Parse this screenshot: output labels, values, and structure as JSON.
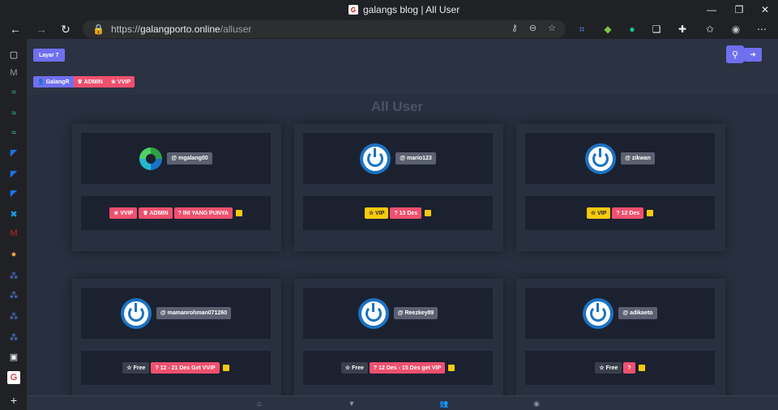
{
  "window": {
    "title": "galangs blog | All User",
    "favicon_glyph": "G"
  },
  "address": {
    "scheme": "https://",
    "host": "galangporto.online",
    "path": "/alluser"
  },
  "toolbar": {
    "layar_label": "Layar 7"
  },
  "current_user": {
    "name": "GalangR",
    "badges": [
      "ADMIN",
      "VVIP"
    ]
  },
  "page_title": "All User",
  "users": [
    {
      "username": "@ mgalang00",
      "avatar": "gravatar",
      "badges": [
        {
          "label": "VVIP",
          "style": "pink",
          "icon": "★"
        },
        {
          "label": "ADMIN",
          "style": "pink",
          "icon": "♛"
        },
        {
          "label": "? INI YANG PUNYA",
          "style": "pink",
          "icon": ""
        }
      ]
    },
    {
      "username": "@ mario123",
      "avatar": "power",
      "badges": [
        {
          "label": "VIP",
          "style": "yellow",
          "icon": "☆"
        },
        {
          "label": "? 13 Des",
          "style": "pink",
          "icon": ""
        }
      ]
    },
    {
      "username": "@ zikwan",
      "avatar": "power",
      "badges": [
        {
          "label": "VIP",
          "style": "yellow",
          "icon": "☆"
        },
        {
          "label": "? 12 Des",
          "style": "pink",
          "icon": ""
        }
      ]
    },
    {
      "username": "@ mamanrohman071260",
      "avatar": "power",
      "badges": [
        {
          "label": "Free",
          "style": "dark",
          "icon": "☆"
        },
        {
          "label": "? 12 - 21 Des Get VVIP",
          "style": "pink",
          "icon": ""
        }
      ]
    },
    {
      "username": "@ Reezkey89",
      "avatar": "power",
      "badges": [
        {
          "label": "Free",
          "style": "dark",
          "icon": "☆"
        },
        {
          "label": "? 12 Des - 15 Des get VIP",
          "style": "pink",
          "icon": ""
        }
      ]
    },
    {
      "username": "@ adikaeto",
      "avatar": "power",
      "badges": [
        {
          "label": "Free",
          "style": "dark",
          "icon": "☆"
        },
        {
          "label": "?",
          "style": "pink",
          "icon": ""
        }
      ]
    }
  ],
  "colors": {
    "accent": "#6f6ff0",
    "pink": "#f0506e",
    "yellow": "#f6c90e",
    "card_inner": "#1c2130"
  }
}
